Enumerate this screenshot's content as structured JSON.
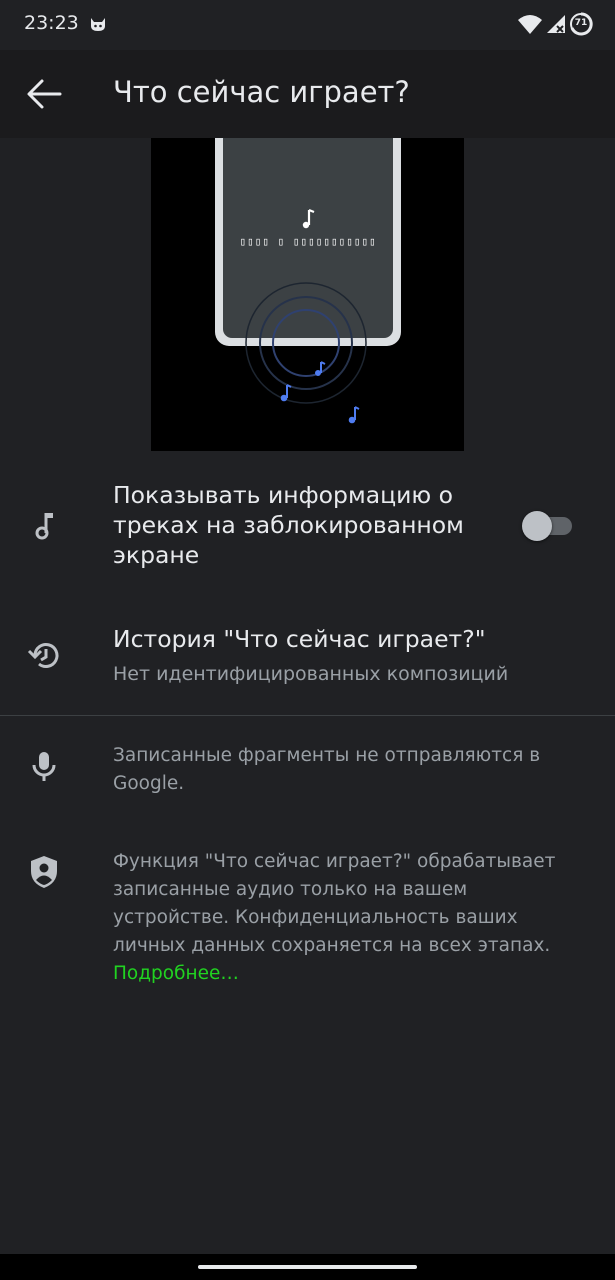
{
  "status_bar": {
    "time": "23:23",
    "battery_level": "71"
  },
  "header": {
    "title": "Что сейчас играет?",
    "back_icon": "arrow-back-icon"
  },
  "illustration": {
    "lyrics_text": "▯▯▯▯ ▯ ▯▯▯▯▯▯▯▯▯▯▯",
    "note_color": "#4f7cf0"
  },
  "settings": {
    "lockscreen_toggle": {
      "icon": "music-note-icon",
      "title": "Показывать информацию о треках на заблокированном экране",
      "enabled": false
    },
    "history": {
      "icon": "history-icon",
      "title": "История \"Что сейчас играет?\"",
      "subtitle": "Нет идентифицированных композиций"
    }
  },
  "info": {
    "mic_text": "Записанные фрагменты не отправляются в Google.",
    "privacy_text": "Функция \"Что сейчас играет?\" обрабатывает записанные аудио только на вашем устройстве. Конфиденциальность ваших личных данных сохраняется на всех этапах.",
    "learn_more": "Подробнее…",
    "link_color": "#21d321"
  }
}
